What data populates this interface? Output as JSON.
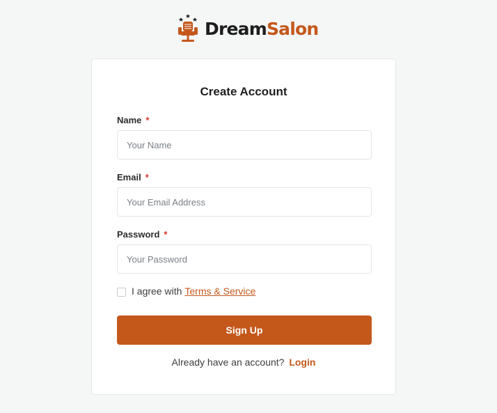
{
  "brand": {
    "name_part1": "Dream",
    "name_part2": "Salon",
    "logo_icon": "barber-chair-icon",
    "accent_color": "#c4581b"
  },
  "form": {
    "title": "Create Account",
    "fields": [
      {
        "label": "Name",
        "required_mark": "*",
        "placeholder": "Your Name",
        "value": ""
      },
      {
        "label": "Email",
        "required_mark": "*",
        "placeholder": "Your Email Address",
        "value": ""
      },
      {
        "label": "Password",
        "required_mark": "*",
        "placeholder": "Your Password",
        "value": ""
      }
    ],
    "agree_text": "I agree with",
    "terms_link": "Terms & Service",
    "agree_checked": false,
    "submit_label": "Sign Up",
    "have_account_text": "Already have an account?",
    "login_link": "Login"
  }
}
